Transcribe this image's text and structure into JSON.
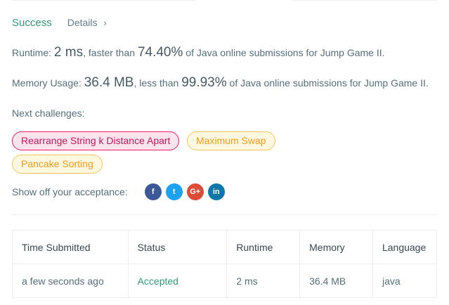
{
  "result": {
    "status": "Success",
    "details_label": "Details",
    "chevron": "›"
  },
  "runtime": {
    "label": "Runtime:",
    "value": "2 ms",
    "faster_label": ", faster than",
    "percent": "74.40%",
    "suffix": "of Java online submissions for Jump Game II."
  },
  "memory": {
    "label": "Memory Usage:",
    "value": "36.4 MB",
    "less_label": ", less than",
    "percent": "99.93%",
    "suffix": "of Java online submissions for Jump Game II."
  },
  "next": {
    "label": "Next challenges:",
    "items": [
      {
        "title": "Rearrange String k Distance Apart",
        "difficulty": "hard"
      },
      {
        "title": "Maximum Swap",
        "difficulty": "medium"
      },
      {
        "title": "Pancake Sorting",
        "difficulty": "medium"
      }
    ]
  },
  "share": {
    "label": "Show off your acceptance:",
    "icons": [
      {
        "name": "facebook-icon",
        "glyph": "f"
      },
      {
        "name": "twitter-icon",
        "glyph": "t"
      },
      {
        "name": "google-plus-icon",
        "glyph": "G+"
      },
      {
        "name": "linkedin-icon",
        "glyph": "in"
      }
    ]
  },
  "table": {
    "headers": [
      "Time Submitted",
      "Status",
      "Runtime",
      "Memory",
      "Language"
    ],
    "rows": [
      {
        "time": "a few seconds ago",
        "status": "Accepted",
        "runtime": "2 ms",
        "memory": "36.4 MB",
        "language": "java"
      }
    ]
  },
  "colors": {
    "success": "#2e9b71",
    "hard": "#e91e63",
    "medium": "#f29a1a"
  }
}
